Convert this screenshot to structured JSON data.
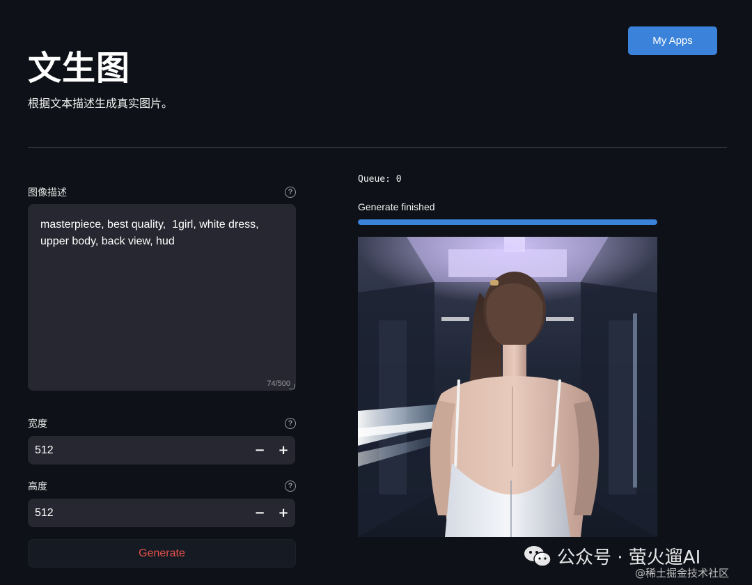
{
  "header": {
    "my_apps_label": "My Apps",
    "title": "文生图",
    "subtitle": "根据文本描述生成真实图片。"
  },
  "form": {
    "prompt": {
      "label": "图像描述",
      "value": "masterpiece, best quality,  1girl, white dress, upper body, back view, hud",
      "char_count": "74/500"
    },
    "width": {
      "label": "宽度",
      "value": "512"
    },
    "height": {
      "label": "高度",
      "value": "512"
    },
    "stepper": {
      "minus": "−",
      "plus": "+"
    },
    "help_glyph": "?",
    "generate_label": "Generate"
  },
  "output": {
    "queue": "Queue: 0",
    "status": "Generate finished",
    "progress": 1.0
  },
  "watermark": {
    "main": "公众号 · 萤火遛AI",
    "sub": "@稀土掘金技术社区"
  },
  "colors": {
    "accent": "#3b82db",
    "background": "#0e1117",
    "input_bg": "#262730",
    "generate_text": "#e5524d"
  },
  "icons": {
    "help": "question-circle-icon",
    "watermark": "wechat-icon"
  }
}
